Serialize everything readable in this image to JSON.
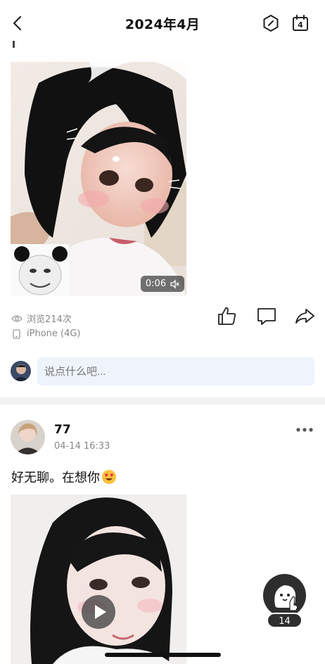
{
  "header": {
    "title": "2024年4月",
    "back_icon": "chevron-left-icon",
    "hex_icon": "hexagon-icon",
    "calendar_day": "4"
  },
  "post1": {
    "video_duration": "0:06",
    "views": "浏览214次",
    "device": "iPhone (4G)",
    "comment_placeholder": "说点什么吧..."
  },
  "post2": {
    "username": "77",
    "time": "04-14 16:33",
    "text": "好无聊。在想你"
  },
  "float": {
    "count": "14"
  }
}
